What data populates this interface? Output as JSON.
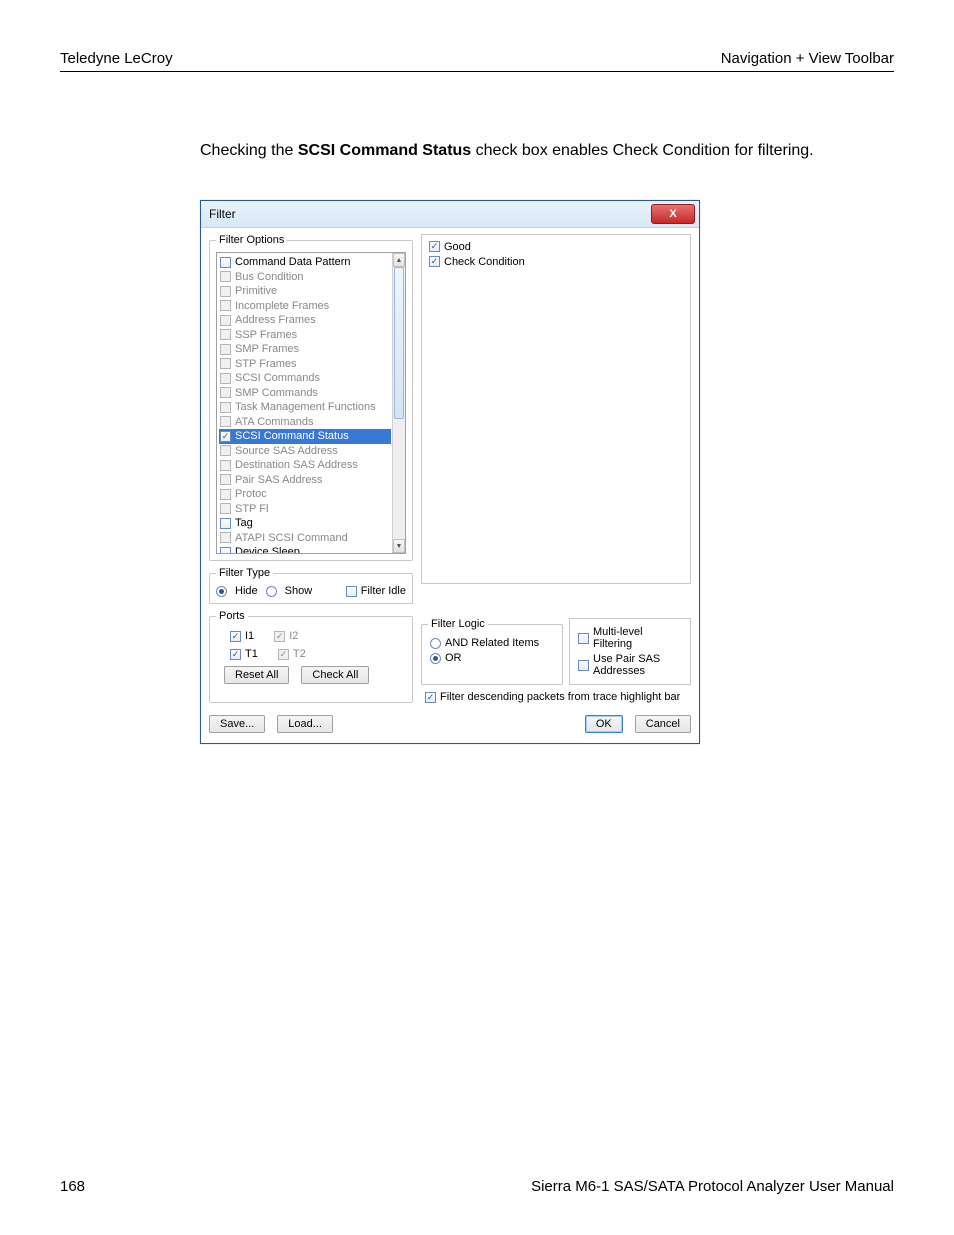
{
  "header": {
    "left": "Teledyne LeCroy",
    "right": "Navigation + View Toolbar"
  },
  "body_text": {
    "prefix": "Checking the ",
    "bold": "SCSI Command Status",
    "suffix": " check box enables Check Condition for filtering."
  },
  "dialog": {
    "title": "Filter",
    "close": "X",
    "filter_options": {
      "legend": "Filter Options",
      "items": [
        {
          "label": "Command Data Pattern",
          "checked": false,
          "disabled": false
        },
        {
          "label": "Bus Condition",
          "checked": false,
          "disabled": true
        },
        {
          "label": "Primitive",
          "checked": false,
          "disabled": true
        },
        {
          "label": "Incomplete Frames",
          "checked": false,
          "disabled": true
        },
        {
          "label": "Address Frames",
          "checked": false,
          "disabled": true
        },
        {
          "label": "SSP Frames",
          "checked": false,
          "disabled": true
        },
        {
          "label": "SMP Frames",
          "checked": false,
          "disabled": true
        },
        {
          "label": "STP Frames",
          "checked": false,
          "disabled": true
        },
        {
          "label": "SCSI Commands",
          "checked": false,
          "disabled": true
        },
        {
          "label": "SMP Commands",
          "checked": false,
          "disabled": true
        },
        {
          "label": "Task Management Functions",
          "checked": false,
          "disabled": true
        },
        {
          "label": "ATA Commands",
          "checked": false,
          "disabled": true
        },
        {
          "label": "SCSI Command Status",
          "checked": true,
          "disabled": false,
          "selected": true
        },
        {
          "label": "Source SAS Address",
          "checked": false,
          "disabled": true
        },
        {
          "label": "Destination SAS Address",
          "checked": false,
          "disabled": true
        },
        {
          "label": "Pair SAS Address",
          "checked": false,
          "disabled": true
        },
        {
          "label": "Protoc",
          "checked": false,
          "disabled": true
        },
        {
          "label": "STP Fl",
          "checked": false,
          "disabled": true
        },
        {
          "label": "Tag",
          "checked": false,
          "disabled": false
        },
        {
          "label": "ATAPI SCSI Command",
          "checked": false,
          "disabled": true
        },
        {
          "label": "Device Sleep",
          "checked": false,
          "disabled": false
        }
      ]
    },
    "status_items": [
      {
        "label": "Good",
        "checked": true
      },
      {
        "label": "Check Condition",
        "checked": true
      }
    ],
    "filter_type": {
      "legend": "Filter Type",
      "hide": "Hide",
      "show": "Show",
      "selected": "hide",
      "filter_idle": "Filter Idle",
      "filter_idle_checked": false
    },
    "ports": {
      "legend": "Ports",
      "items": [
        {
          "label": "I1",
          "checked": true,
          "disabled": false
        },
        {
          "label": "I2",
          "checked": true,
          "disabled": true
        },
        {
          "label": "T1",
          "checked": true,
          "disabled": false
        },
        {
          "label": "T2",
          "checked": true,
          "disabled": true
        }
      ],
      "reset_all": "Reset All",
      "check_all": "Check All"
    },
    "filter_logic": {
      "legend": "Filter Logic",
      "and": "AND Related Items",
      "or": "OR",
      "selected": "or"
    },
    "multilevel": {
      "ml": "Multi-level Filtering",
      "pair": "Use Pair SAS Addresses"
    },
    "descending": {
      "label": "Filter descending packets from trace highlight bar",
      "checked": true
    },
    "buttons": {
      "save": "Save...",
      "load": "Load...",
      "ok": "OK",
      "cancel": "Cancel"
    }
  },
  "footer": {
    "page": "168",
    "title": "Sierra M6-1 SAS/SATA Protocol Analyzer User Manual"
  }
}
